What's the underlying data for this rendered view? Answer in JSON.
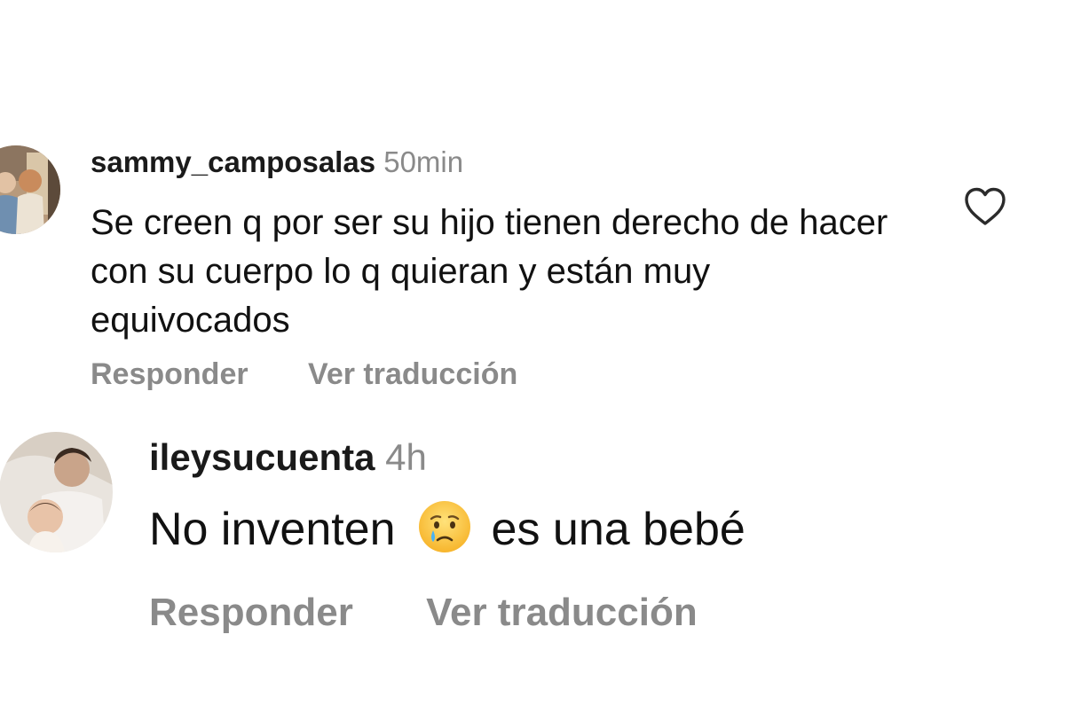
{
  "comments": [
    {
      "username": "sammy_camposalas",
      "time": "50min",
      "text": "Se creen q por ser su hijo tienen derecho de hacer con su cuerpo lo q quieran y están muy equivocados",
      "reply_label": "Responder",
      "translate_label": "Ver traducción",
      "like_icon": "heart-outline-icon"
    },
    {
      "username": "ileysucuenta",
      "time": "4h",
      "text_before_emoji": "No inventen",
      "emoji": "crying-face-emoji",
      "text_after_emoji": "es una bebé",
      "reply_label": "Responder",
      "translate_label": "Ver traducción"
    }
  ],
  "colors": {
    "username": "#1a1a1a",
    "secondary_text": "#8a8a8a",
    "body_text": "#111111",
    "background": "#ffffff"
  }
}
